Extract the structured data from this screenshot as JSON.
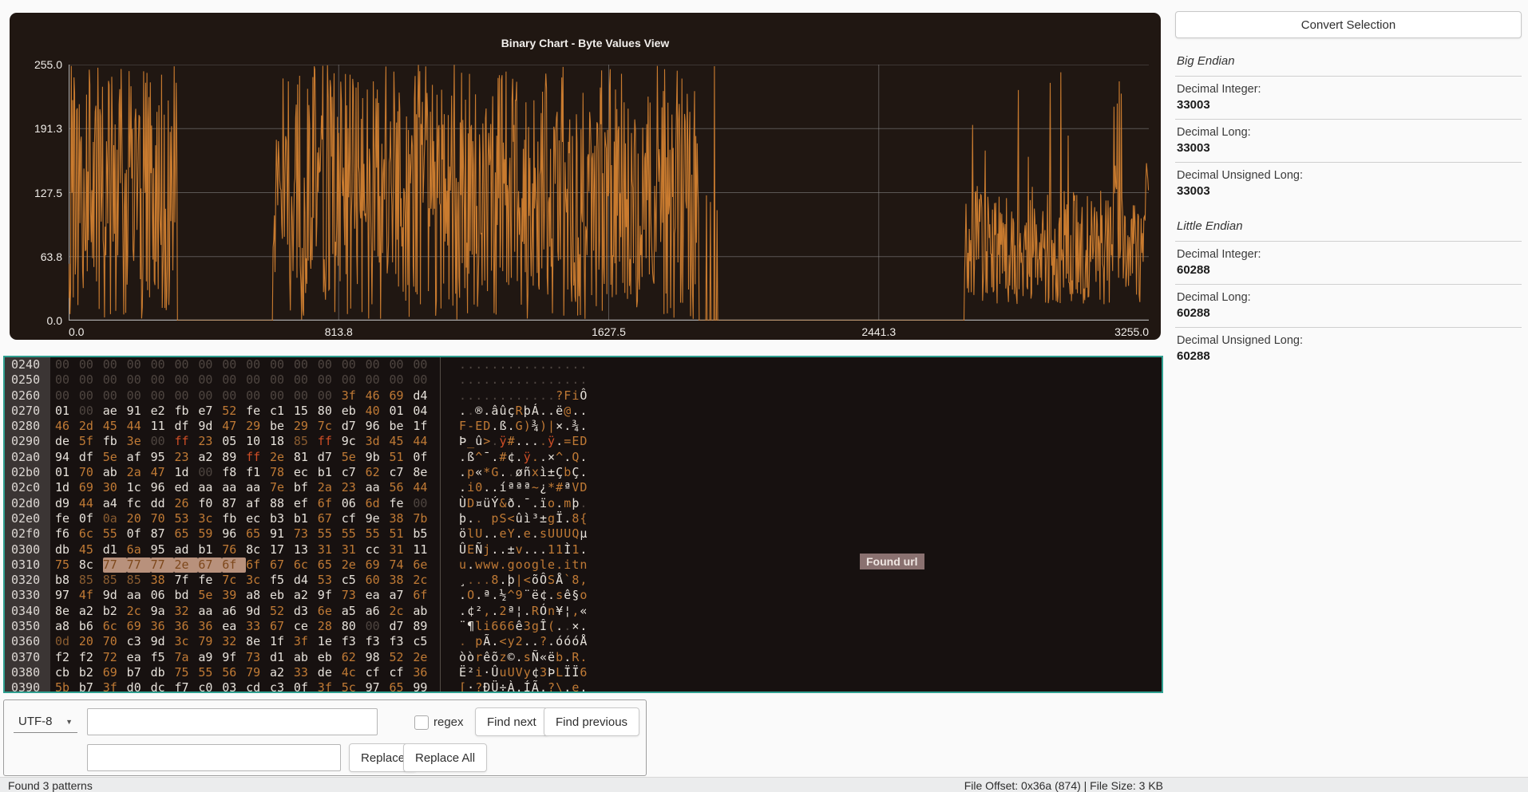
{
  "chart": {
    "title": "Binary Chart - Byte Values View",
    "chart_data": {
      "type": "line",
      "title": "Binary Chart - Byte Values View",
      "xlabel": "",
      "ylabel": "",
      "xlim": [
        0,
        3255
      ],
      "ylim": [
        0,
        255
      ],
      "x_ticks": [
        "0.0",
        "813.8",
        "1627.5",
        "2441.3",
        "3255.0"
      ],
      "y_ticks": [
        "255.0",
        "191.3",
        "127.5",
        "63.8",
        "0.0"
      ],
      "grid": true,
      "legend": false,
      "line_color": "#c97b2f",
      "background": "#201712",
      "series_note": "raw byte values 0-255 across 3255 file bytes, approximated by segments",
      "segments": [
        {
          "from": 0,
          "to": 327,
          "mode": "noise",
          "min": 0,
          "max": 255
        },
        {
          "from": 327,
          "to": 616,
          "mode": "flat",
          "value": 0
        },
        {
          "from": 616,
          "to": 1900,
          "mode": "noise",
          "min": 0,
          "max": 255
        },
        {
          "from": 1900,
          "to": 2000,
          "mode": "sparse",
          "min": 80,
          "max": 255,
          "density": 0.12
        },
        {
          "from": 2000,
          "to": 2700,
          "mode": "flat",
          "value": 0
        },
        {
          "from": 2700,
          "to": 3240,
          "mode": "mixed",
          "min": 15,
          "max": 135,
          "spike_min": 150,
          "spike_max": 255,
          "spike_density": 0.05
        },
        {
          "from": 3240,
          "to": 3255,
          "mode": "noise",
          "min": 80,
          "max": 160
        }
      ]
    }
  },
  "hex_editor": {
    "border_color": "#2f9f90",
    "found_badge": "Found url",
    "byte_colors": {
      "d": "#4e4540",
      "w": "#e6e1da",
      "p": "#c07a35",
      "s": "#8a5c30",
      "f": "#cf4e26",
      "h_bg": "#b8917c",
      "h_text": "#7e481c"
    },
    "rows": [
      {
        "offset": "0240",
        "bytes": "00 00 00 00 00 00 00 00 00 00 00 00 00 00 00 00",
        "cls": "dddddddddddddddd",
        "ascii": "................"
      },
      {
        "offset": "0250",
        "bytes": "00 00 00 00 00 00 00 00 00 00 00 00 00 00 00 00",
        "cls": "dddddddddddddddd",
        "ascii": "................"
      },
      {
        "offset": "0260",
        "bytes": "00 00 00 00 00 00 00 00 00 00 00 00 3f 46 69 d4",
        "cls": "ddddddddddddpppw",
        "ascii": "............?FiÔ"
      },
      {
        "offset": "0270",
        "bytes": "01 00 ae 91 e2 fb e7 52 fe c1 15 80 eb 40 01 04",
        "cls": "wdwwwwwpwwwwwpww",
        "ascii": "..®.âûçRþÁ..ë@.."
      },
      {
        "offset": "0280",
        "bytes": "46 2d 45 44 11 df 9d 47 29 be 29 7c d7 96 be 1f",
        "cls": "ppppwwwppwppwwww",
        "ascii": "F-ED.ß.G)¾)|×.¾."
      },
      {
        "offset": "0290",
        "bytes": "de 5f fb 3e 00 ff 23 05 10 18 85 ff 9c 3d 45 44",
        "cls": "wpwpdfpwwwsfwppp",
        "ascii": "Þ_û>.ÿ#....ÿ.=ED"
      },
      {
        "offset": "02a0",
        "bytes": "94 df 5e af 95 23 a2 89 ff 2e 81 d7 5e 9b 51 0f",
        "cls": "wwpwwpwwfpwwpwpw",
        "ascii": ".ß^¯.#¢.ÿ..×^.Q."
      },
      {
        "offset": "02b0",
        "bytes": "01 70 ab 2a 47 1d 00 f8 f1 78 ec b1 c7 62 c7 8e",
        "cls": "wpwppwdwwpwwwpww",
        "ascii": ".p«*G..øñxì±ÇbÇ."
      },
      {
        "offset": "02c0",
        "bytes": "1d 69 30 1c 96 ed aa aa aa 7e bf 2a 23 aa 56 44",
        "cls": "wppwwwwwwpwppwpp",
        "ascii": ".i0..íªªª~¿*#ªVD"
      },
      {
        "offset": "02d0",
        "bytes": "d9 44 a4 fc dd 26 f0 87 af 88 ef 6f 06 6d fe 00",
        "cls": "wpwwwpwwwwwpwpwd",
        "ascii": "ÙD¤üÝ&ð.¯.ïo.mþ."
      },
      {
        "offset": "02e0",
        "bytes": "fe 0f 0a 20 70 53 3c fb ec b3 b1 67 cf 9e 38 7b",
        "cls": "wwsppppwwwwpwwpp",
        "ascii": "þ.. pS<ûì³±gÏ.8{"
      },
      {
        "offset": "02f0",
        "bytes": "f6 6c 55 0f 87 65 59 96 65 91 73 55 55 55 51 b5",
        "cls": "wppwwppwpwpppppw",
        "ascii": "ölU..eY.e.sUUUQµ"
      },
      {
        "offset": "0300",
        "bytes": "db 45 d1 6a 95 ad b1 76 8c 17 13 31 31 cc 31 11",
        "cls": "wpwpwwwpwwwppwpw",
        "ascii": "ÛEÑj..±v...11Ì1."
      },
      {
        "offset": "0310",
        "bytes": "75 8c 77 77 77 2e 67 6f 6f 67 6c 65 2e 69 74 6e",
        "cls": "pwhhhhhhpppppppp",
        "ascii": "u.www.google.itn"
      },
      {
        "offset": "0320",
        "bytes": "b8 85 85 85 38 7f fe 7c 3c f5 d4 53 c5 60 38 2c",
        "cls": "wssspwwppwwpwppp",
        "ascii": "¸...8.þ|<õÔSÅ`8,"
      },
      {
        "offset": "0330",
        "bytes": "97 4f 9d aa 06 bd 5e 39 a8 eb a2 9f 73 ea a7 6f",
        "cls": "wpwwwwppwwwwpwwp",
        "ascii": ".O.ª.½^9¨ë¢.sê§o"
      },
      {
        "offset": "0340",
        "bytes": "8e a2 b2 2c 9a 32 aa a6 9d 52 d3 6e a5 a6 2c ab",
        "cls": "wwwpwpwwwpwpwwpw",
        "ascii": ".¢²,.2ª¦.RÓn¥¦,«"
      },
      {
        "offset": "0350",
        "bytes": "a8 b6 6c 69 36 36 36 ea 33 67 ce 28 80 00 d7 89",
        "cls": "wwpppppwppwpwdww",
        "ascii": "¨¶li666ê3gÎ(..×."
      },
      {
        "offset": "0360",
        "bytes": "0d 20 70 c3 9d 3c 79 32 8e 1f 3f 1e f3 f3 f3 c5",
        "cls": "sppwwpppwwpwwwww",
        "ascii": ". pÃ.<y2..?.óóóÅ"
      },
      {
        "offset": "0370",
        "bytes": "f2 f2 72 ea f5 7a a9 9f 73 d1 ab eb 62 98 52 2e",
        "cls": "wwpwwpwwpwwwpwpp",
        "ascii": "òòrêõz©.sÑ«ëb.R."
      },
      {
        "offset": "0380",
        "bytes": "cb b2 69 b7 db 75 55 56 79 a2 33 de 4c cf cf 36",
        "cls": "wwpwwppppwpwpwwp",
        "ascii": "Ë²i·ÛuUVy¢3ÞLÏÏ6"
      },
      {
        "offset": "0390",
        "bytes": "5b b7 3f d0 dc f7 c0 03 cd c3 0f 3f 5c 97 65 99",
        "cls": "pwpwwwwwwwwppwpw",
        "ascii": "[·?ÐÜ÷À.ÍÃ.?\\.e."
      }
    ]
  },
  "convert_panel": {
    "button": "Convert Selection",
    "sections": [
      {
        "header": "Big Endian",
        "rows": [
          {
            "label": "Decimal Integer:",
            "value": "33003"
          },
          {
            "label": "Decimal Long:",
            "value": "33003"
          },
          {
            "label": "Decimal Unsigned Long:",
            "value": "33003"
          }
        ]
      },
      {
        "header": "Little Endian",
        "rows": [
          {
            "label": "Decimal Integer:",
            "value": "60288"
          },
          {
            "label": "Decimal Long:",
            "value": "60288"
          },
          {
            "label": "Decimal Unsigned Long:",
            "value": "60288"
          }
        ]
      }
    ]
  },
  "search": {
    "encoding": "UTF-8",
    "search_value": "",
    "search_placeholder": "",
    "regex_label": "regex",
    "find_next": "Find next",
    "find_previous": "Find previous",
    "replace_value": "",
    "replace": "Replace",
    "replace_all": "Replace All"
  },
  "status_bar": {
    "left": "Found 3 patterns",
    "right": "File Offset: 0x36a (874) | File Size: 3 KB"
  }
}
